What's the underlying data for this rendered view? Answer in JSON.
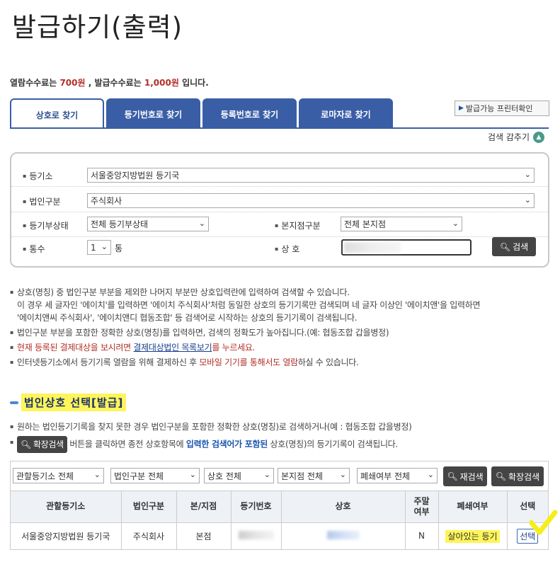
{
  "page": {
    "title": "발급하기(출력)"
  },
  "fee": {
    "prefix": "열람수수료는",
    "view_fee": "700원",
    "mid": ", 발급수수료는",
    "issue_fee": "1,000원",
    "suffix": "입니다."
  },
  "tabs": [
    {
      "label": "상호로 찾기",
      "active": true
    },
    {
      "label": "등기번호로 찾기",
      "active": false
    },
    {
      "label": "등록번호로 찾기",
      "active": false
    },
    {
      "label": "로마자로 찾기",
      "active": false
    }
  ],
  "printer_button": "발급가능 프린터확인",
  "collapse_label": "검색 감추기",
  "form": {
    "registry_label": "등기소",
    "registry_value": "서울중앙지방법원 등기국",
    "corp_type_label": "법인구분",
    "corp_type_value": "주식회사",
    "status_label": "등기부상태",
    "status_value": "전체 등기부상태",
    "branch_label": "본지점구분",
    "branch_value": "전체 본지점",
    "count_label": "통수",
    "count_value": "1",
    "count_unit": "통",
    "name_label": "상 호",
    "search_button": "검색"
  },
  "notes": {
    "n1": "상호(명칭) 중 법인구분 부분을 제외한 나머지 부분만 상호입력란에 입력하여 검색할 수 있습니다.",
    "n1b": "이 경우 세 글자인 '에이치'를 입력하면 '에이치 주식회사'처럼 동일한 상호의 등기기록만 검색되며 네 글자 이상인 '에이치앤'을 입력하면",
    "n1c": "'에이치앤씨 주식회사', '에이치앤디 협동조합' 등 검색어로 시작하는 상호의 등기기록이 검색됩니다.",
    "n2": "법인구분 부분을 포함한 정확한 상호(명칭)를 입력하면, 검색의 정확도가 높아집니다.(예: 협동조합 갑을병정)",
    "n3a": "현재 등록된 결제대상을 보시려면",
    "n3link": "결제대상법인 목록보기",
    "n3b": "를 누르세요.",
    "n4a": "인터넷등기소에서 등기기록 열람을 위해 결제하신 후",
    "n4red": "모바일 기기를 통해서도 열람",
    "n4b": "하실 수 있습니다."
  },
  "section_title": "법인상호 선택[발급]",
  "notes2": {
    "m1": "원하는 법인등기기록을 찾지 못한 경우 법인구분을 포함한 정확한 상호(명칭)로 검색하거나(예 : 협동조합 갑을병정)",
    "m2_btn": "확장검색",
    "m2a": "버튼을 클릭하면 종전 상호항목에",
    "m2blue": "입력한 검색어가 포함된",
    "m2b": "상호(명칭)의 등기기록이 검색됩니다."
  },
  "filters": {
    "f1": "관할등기소 전체",
    "f2": "법인구분 전체",
    "f3": "상호 전체",
    "f4": "본지점 전체",
    "f5": "폐쇄여부 전체",
    "research_button": "재검색",
    "extended_button": "확장검색"
  },
  "table": {
    "headers": [
      "관할등기소",
      "법인구분",
      "본/지점",
      "등기번호",
      "상호",
      "주말\n여부",
      "폐쇄여부",
      "선택"
    ],
    "h_weekend_1": "주말",
    "h_weekend_2": "여부",
    "rows": [
      {
        "registry": "서울중앙지방법원 등기국",
        "corp_type": "주식회사",
        "branch": "본점",
        "weekend": "N",
        "closed": "살아있는 등기",
        "select": "선택"
      }
    ]
  },
  "colors": {
    "tab_blue": "#3a5ea6",
    "highlight": "#fdf55a",
    "accent_red": "#b0302a",
    "dark_button": "#444444"
  }
}
